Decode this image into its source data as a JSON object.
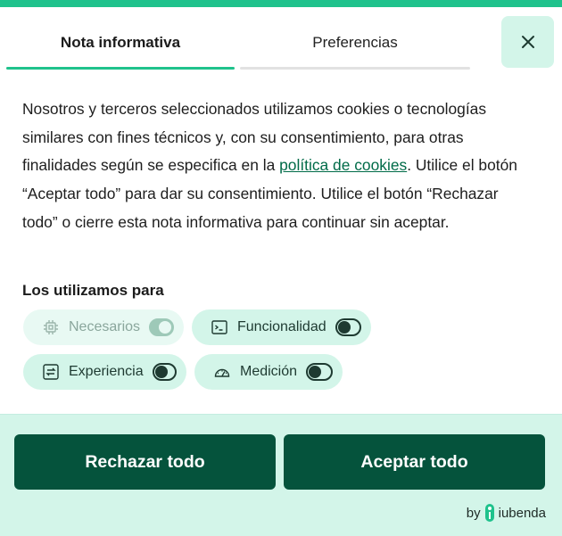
{
  "tabs": [
    {
      "label": "Nota informativa",
      "active": true
    },
    {
      "label": "Preferencias",
      "active": false
    }
  ],
  "close_icon": "close-icon",
  "description": {
    "before_link": "Nosotros y terceros seleccionados utilizamos cookies o tecnologías similares con fines técnicos y, con su consentimiento, para otras finalidades según se especifica en la ",
    "link_text": "política de cookies",
    "after_link": ". Utilice el botón “Aceptar todo” para dar su consentimiento. Utilice el botón “Rechazar todo” o cierre esta nota informativa para continuar sin aceptar."
  },
  "purposes": {
    "title": "Los utilizamos para",
    "items": [
      {
        "label": "Necesarios",
        "icon": "chip-icon",
        "state": "on",
        "disabled": true
      },
      {
        "label": "Funcionalidad",
        "icon": "terminal-icon",
        "state": "off",
        "disabled": false
      },
      {
        "label": "Experiencia",
        "icon": "swap-arrows-icon",
        "state": "off",
        "disabled": false
      },
      {
        "label": "Medición",
        "icon": "gauge-icon",
        "state": "off",
        "disabled": false
      }
    ]
  },
  "buttons": {
    "reject": "Rechazar todo",
    "accept": "Aceptar todo"
  },
  "brand": {
    "prefix": "by",
    "name": "iubenda"
  },
  "colors": {
    "accent": "#1fc28c",
    "primary": "#05533c",
    "chip_bg": "#d3f5e9"
  }
}
